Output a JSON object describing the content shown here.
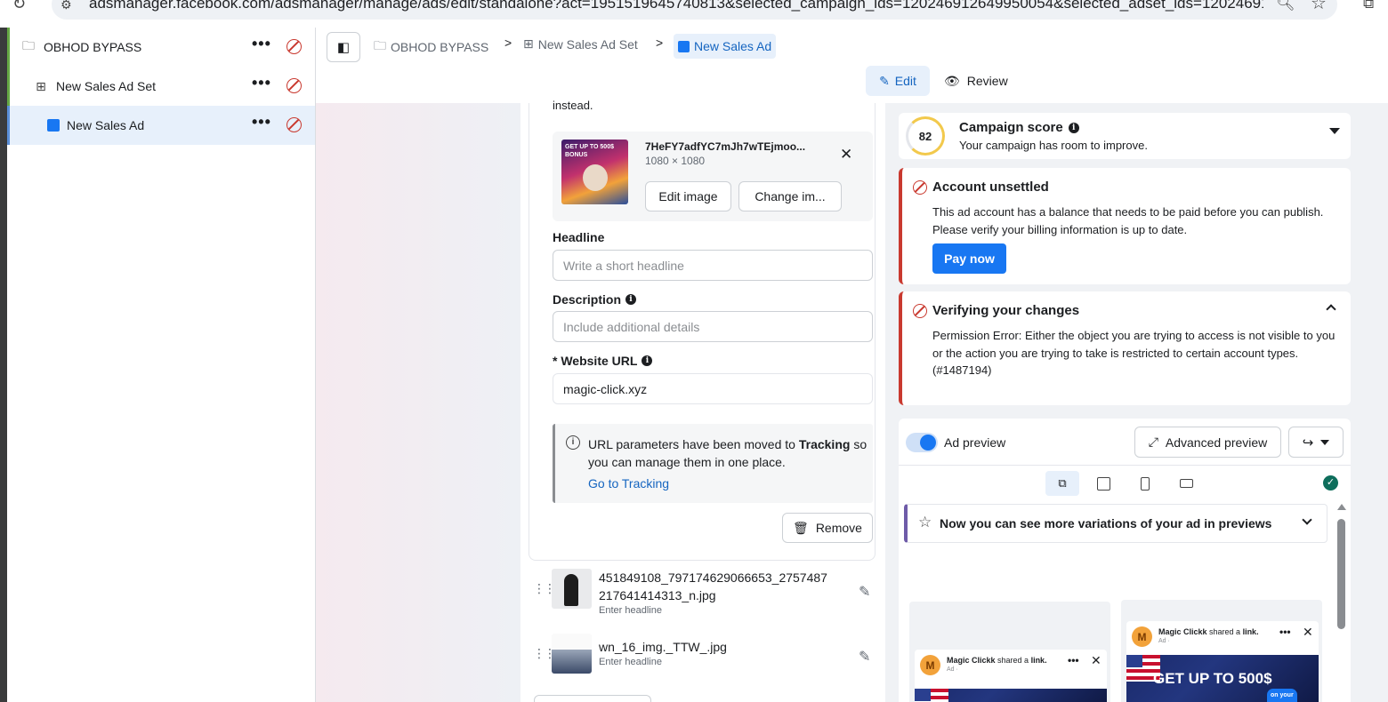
{
  "browser": {
    "url": "adsmanager.facebook.com/adsmanager/manage/ads/edit/standalone?act=1951519645740813&selected_campaign_ids=120246912649950054&selected_adset_ids=12024691..."
  },
  "tree": {
    "campaign": "OBHOD BYPASS",
    "adset": "New Sales Ad Set",
    "ad": "New Sales Ad",
    "more": "•••"
  },
  "breadcrumb": {
    "campaign": "OBHOD BYPASS",
    "adset": "New Sales Ad Set",
    "ad": "New Sales Ad",
    "sep": ">"
  },
  "tabs": {
    "edit": "Edit",
    "review": "Review"
  },
  "editor": {
    "instead": "instead.",
    "image": {
      "filename": "7HeFY7adfYC7mJh7wTEjmoo...",
      "dims": "1080 × 1080",
      "thumb_text": "GET UP TO 500$ BONUS",
      "edit_btn": "Edit image",
      "change_btn": "Change im..."
    },
    "headline": {
      "label": "Headline",
      "placeholder": "Write a short headline"
    },
    "description": {
      "label": "Description",
      "placeholder": "Include additional details"
    },
    "website": {
      "label": "* Website URL",
      "value": "magic-click.xyz"
    },
    "notice": {
      "pre": "URL parameters have been moved to ",
      "bold": "Tracking",
      "post": " so you can manage them in one place.",
      "link": "Go to Tracking"
    },
    "remove_btn": "Remove",
    "assets": [
      {
        "name": "451849108_797174629066653_2757487217641414313_n.jpg",
        "sub": "Enter headline"
      },
      {
        "name": "wn_16_img._TTW_.jpg",
        "sub": "Enter headline"
      }
    ]
  },
  "score": {
    "value": "82",
    "title": "Campaign score",
    "subtitle": "Your campaign has room to improve."
  },
  "alerts": [
    {
      "title": "Account unsettled",
      "body": "This ad account has a balance that needs to be paid before you can publish. Please verify your billing information is up to date.",
      "button": "Pay now"
    },
    {
      "title": "Verifying your changes",
      "body": "Permission Error: Either the object you are trying to access is not visible to you or the action you are trying to take is restricted to certain account types. (#1487194)"
    }
  ],
  "preview": {
    "label": "Ad preview",
    "advanced": "Advanced preview",
    "variations": "Now you can see more variations of your ad in previews",
    "post": {
      "avatar": "M",
      "name": "Magic Clickk",
      "shared": " shared a ",
      "link": "link.",
      "sub": "Ad · ",
      "headline": "GET UP TO 500$",
      "badge": "on your"
    }
  },
  "colors": {
    "accent": "#1877f2",
    "error": "#c9392f",
    "score_ring": "#f2c94c"
  }
}
